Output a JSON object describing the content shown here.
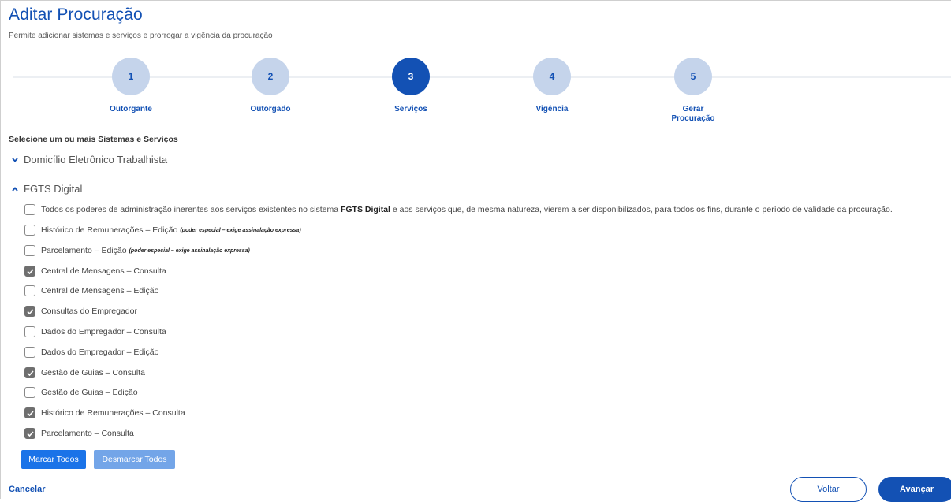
{
  "page": {
    "title": "Aditar Procuração",
    "subtitle": "Permite adicionar sistemas e serviços e prorrogar a vigência da procuração"
  },
  "stepper": {
    "active_step": 3,
    "steps": [
      {
        "number": "1",
        "label": "Outorgante"
      },
      {
        "number": "2",
        "label": "Outorgado"
      },
      {
        "number": "3",
        "label": "Serviços"
      },
      {
        "number": "4",
        "label": "Vigência"
      },
      {
        "number": "5",
        "label": "Gerar Procuração"
      }
    ]
  },
  "selection": {
    "instruction": "Selecione um ou mais Sistemas e Serviços",
    "groups": [
      {
        "name": "Domicílio Eletrônico Trabalhista",
        "expanded": false,
        "chevron_icon": "chevron-down-icon"
      },
      {
        "name": "FGTS Digital",
        "expanded": true,
        "chevron_icon": "chevron-up-icon"
      }
    ],
    "all_powers": {
      "text_before": "Todos os poderes de administração inerentes aos serviços existentes no sistema",
      "system_name": "FGTS Digital",
      "text_after": "e aos serviços que, de mesma natureza, vierem a ser disponibilizados, para todos os fins, durante o período de validade da procuração.",
      "checked": false
    },
    "options": [
      {
        "label": "Histórico de Remunerações – Edição",
        "note": "(poder especial – exige assinalação expressa)",
        "checked": false
      },
      {
        "label": "Parcelamento – Edição",
        "note": "(poder especial – exige assinalação expressa)",
        "checked": false
      },
      {
        "label": "Central de Mensagens – Consulta",
        "checked": true
      },
      {
        "label": "Central de Mensagens – Edição",
        "checked": false
      },
      {
        "label": "Consultas do Empregador",
        "checked": true
      },
      {
        "label": "Dados do Empregador – Consulta",
        "checked": false
      },
      {
        "label": "Dados do Empregador – Edição",
        "checked": false
      },
      {
        "label": "Gestão de Guias – Consulta",
        "checked": true
      },
      {
        "label": "Gestão de Guias – Edição",
        "checked": false
      },
      {
        "label": "Histórico de Remunerações – Consulta",
        "checked": true
      },
      {
        "label": "Parcelamento – Consulta",
        "checked": true
      }
    ],
    "mark_all_label": "Marcar Todos",
    "unmark_all_label": "Desmarcar Todos"
  },
  "footer": {
    "cancel_label": "Cancelar",
    "back_label": "Voltar",
    "next_label": "Avançar"
  },
  "colors": {
    "primary": "#1351b4",
    "step_inactive": "#c5d4eb",
    "mark_all_button": "#1a73e8",
    "unmark_all_button": "#73a5e8",
    "checkbox_checked": "#6f6f6f"
  }
}
